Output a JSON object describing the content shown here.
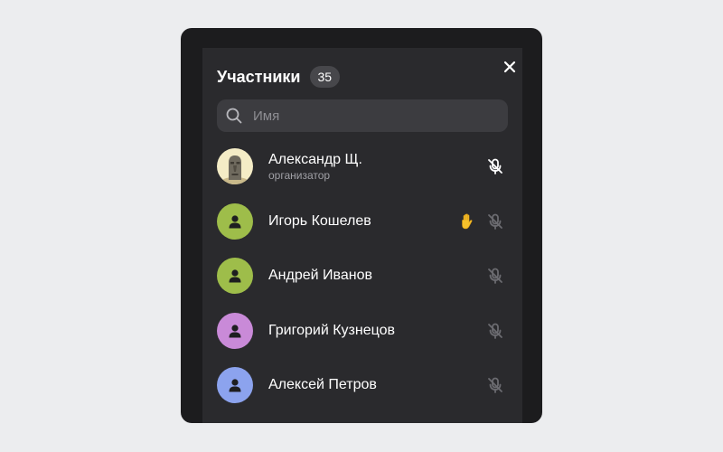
{
  "panel": {
    "title": "Участники",
    "count": "35",
    "close_icon": "close-icon"
  },
  "search": {
    "placeholder": "Имя",
    "value": "",
    "icon": "search-icon"
  },
  "participants": [
    {
      "name": "Александр Щ.",
      "role": "организатор",
      "avatar": "photo-avatar",
      "hand_raised": false,
      "mic": "muted",
      "mic_color": "#ffffff"
    },
    {
      "name": "Игорь Кошелев",
      "role": "",
      "avatar": "person-icon",
      "avatar_color": "#9ebd4a",
      "hand_raised": true,
      "mic": "muted",
      "mic_color": "#6b6b70"
    },
    {
      "name": "Андрей Иванов",
      "role": "",
      "avatar": "person-icon",
      "avatar_color": "#9ebd4a",
      "hand_raised": false,
      "mic": "muted",
      "mic_color": "#6b6b70"
    },
    {
      "name": "Григорий Кузнецов",
      "role": "",
      "avatar": "person-icon",
      "avatar_color": "#c98ad8",
      "hand_raised": false,
      "mic": "muted",
      "mic_color": "#6b6b70"
    },
    {
      "name": "Алексей Петров",
      "role": "",
      "avatar": "person-icon",
      "avatar_color": "#8ca3ee",
      "hand_raised": false,
      "mic": "muted",
      "mic_color": "#6b6b70"
    }
  ],
  "colors": {
    "page_bg": "#ecedef",
    "frame_bg": "#1c1c1e",
    "panel_bg": "#2a2a2d",
    "search_bg": "#3c3c40",
    "hand_color": "#f5c02b"
  }
}
